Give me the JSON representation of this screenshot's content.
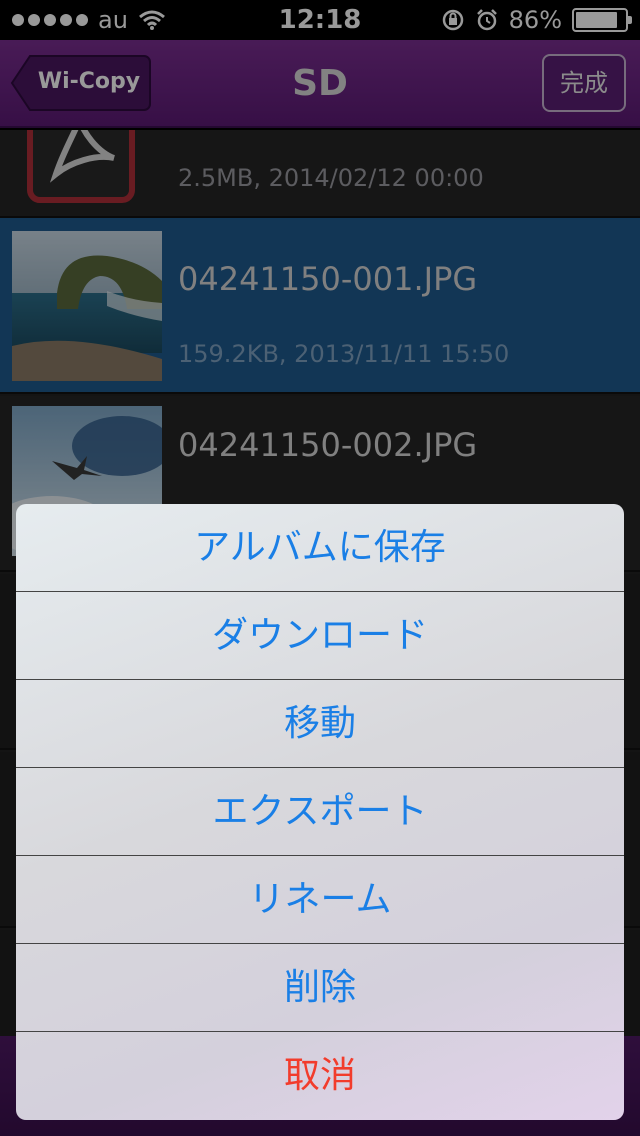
{
  "status_bar": {
    "carrier": "au",
    "time": "12:18",
    "battery_percent": "86%",
    "battery_level": 0.86,
    "icons": [
      "signal-dots-icon",
      "wifi-icon",
      "rotation-lock-icon",
      "alarm-icon",
      "battery-icon"
    ]
  },
  "nav": {
    "back_label": "Wi-Copy",
    "title": "SD",
    "done_label": "完成"
  },
  "files": [
    {
      "name": "",
      "meta": "2.5MB, 2014/02/12 00:00",
      "icon": "pdf-icon",
      "selected": false
    },
    {
      "name": "04241150-001.JPG",
      "meta": "159.2KB, 2013/11/11 15:50",
      "icon": "photo-thumbnail",
      "selected": true
    },
    {
      "name": "04241150-002.JPG",
      "meta": "",
      "icon": "photo-thumbnail",
      "selected": false
    }
  ],
  "action_sheet": {
    "items": [
      {
        "label": "アルバムに保存"
      },
      {
        "label": "ダウンロード"
      },
      {
        "label": "移動"
      },
      {
        "label": "エクスポート"
      },
      {
        "label": "リネーム"
      },
      {
        "label": "削除"
      }
    ],
    "cancel_label": "取消"
  },
  "colors": {
    "nav_purple": "#6a2383",
    "selected_row": "#1e5a8e",
    "action_text": "#1a7fe6",
    "cancel_text": "#f23c2c"
  }
}
